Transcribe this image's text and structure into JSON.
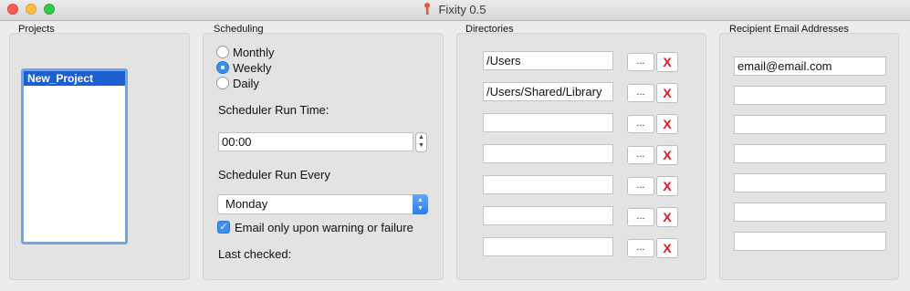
{
  "window": {
    "title": "Fixity 0.5"
  },
  "projects": {
    "title": "Projects",
    "items": [
      "New_Project"
    ]
  },
  "scheduling": {
    "title": "Scheduling",
    "options": [
      "Monthly",
      "Weekly",
      "Daily"
    ],
    "selected": "Weekly",
    "run_time_label": "Scheduler Run Time:",
    "run_time": "00:00",
    "run_every_label": "Scheduler Run Every",
    "run_every": "Monday",
    "email_only_label": "Email only upon warning or failure",
    "email_only_checked": true,
    "last_checked_label": "Last checked:"
  },
  "directories": {
    "title": "Directories",
    "paths": [
      "/Users",
      "/Users/Shared/Library",
      "",
      "",
      "",
      "",
      ""
    ],
    "browse_label": "...",
    "remove_label": "X"
  },
  "emails": {
    "title": "Recipient Email Addresses",
    "addresses": [
      "email@email.com",
      "",
      "",
      "",
      "",
      "",
      ""
    ]
  }
}
